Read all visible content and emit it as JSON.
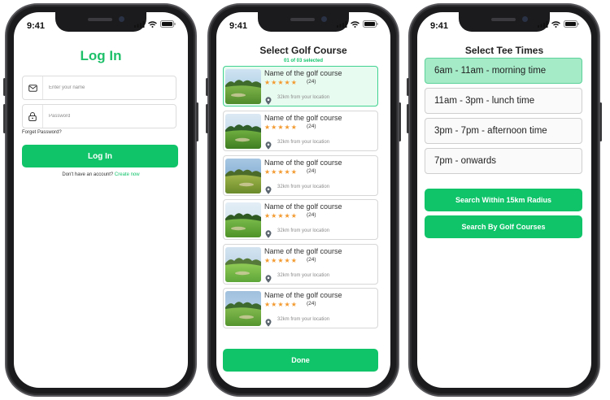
{
  "colors": {
    "brand_green": "#10c46a",
    "star_orange": "#f39a2f",
    "selected_bg": "#e8fbf1",
    "active_slot": "#a5ebc8"
  },
  "status_bar": {
    "time": "9:41"
  },
  "login": {
    "title": "Log In",
    "name_placeholder": "Enter your name",
    "password_placeholder": "Password",
    "forgot": "Forget Password?",
    "login_button": "Log In",
    "signup_prompt": "Don't have an account?",
    "signup_link": "Create now",
    "icons": [
      "mail-icon",
      "lock-icon"
    ]
  },
  "courses": {
    "title": "Select Golf Course",
    "selected_count": "01 of 03 selected",
    "items": [
      {
        "name": "Name of the golf course",
        "rating": 5,
        "reviews": "(24)",
        "distance": "32km from your location",
        "selected": true
      },
      {
        "name": "Name of the golf course",
        "rating": 5,
        "reviews": "(24)",
        "distance": "32km from your location",
        "selected": false
      },
      {
        "name": "Name of the golf course",
        "rating": 5,
        "reviews": "(24)",
        "distance": "32km from your location",
        "selected": false
      },
      {
        "name": "Name of the golf course",
        "rating": 5,
        "reviews": "(24)",
        "distance": "32km from your location",
        "selected": false
      },
      {
        "name": "Name of the golf course",
        "rating": 5,
        "reviews": "(24)",
        "distance": "32km from your location",
        "selected": false
      },
      {
        "name": "Name of the golf course",
        "rating": 5,
        "reviews": "(24)",
        "distance": "32km from your location",
        "selected": false
      }
    ],
    "done_button": "Done"
  },
  "tee_times": {
    "title": "Select Tee Times",
    "slots": [
      {
        "label": "6am - 11am - morning time",
        "active": true
      },
      {
        "label": "11am - 3pm - lunch time",
        "active": false
      },
      {
        "label": "3pm - 7pm - afternoon time",
        "active": false
      },
      {
        "label": "7pm - onwards",
        "active": false
      }
    ],
    "radius_button": "Search Within 15km Radius",
    "courses_button": "Search By Golf Courses"
  }
}
